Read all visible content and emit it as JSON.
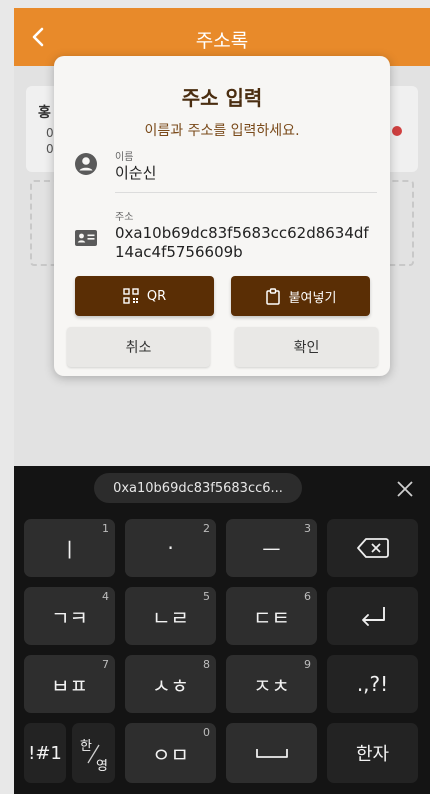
{
  "app_bar": {
    "title": "주소록"
  },
  "background": {
    "card_title": "홍",
    "card_line1": "0",
    "card_line2": "0"
  },
  "dialog": {
    "title": "주소 입력",
    "subtitle": "이름과 주소를 입력하세요.",
    "name_field": {
      "label": "이름",
      "value": "이순신"
    },
    "address_field": {
      "label": "주소",
      "value_line1": "0xa10b69dc83f5683cc62d8634df",
      "value_line2": "14ac4f5756609b"
    },
    "qr_button": "QR",
    "paste_button": "붙여넣기",
    "cancel_button": "취소",
    "confirm_button": "확인"
  },
  "keyboard": {
    "suggestion": "0xa10b69dc83f5683cc6...",
    "rows": [
      [
        {
          "label": "ㅣ",
          "num": "1"
        },
        {
          "label": "·",
          "num": "2"
        },
        {
          "label": "ㅡ",
          "num": "3"
        }
      ],
      [
        {
          "label": "ㄱㅋ",
          "num": "4"
        },
        {
          "label": "ㄴㄹ",
          "num": "5"
        },
        {
          "label": "ㄷㅌ",
          "num": "6"
        }
      ],
      [
        {
          "label": "ㅂㅍ",
          "num": "7"
        },
        {
          "label": "ㅅㅎ",
          "num": "8"
        },
        {
          "label": "ㅈㅊ",
          "num": "9"
        },
        {
          "label": ".,?!"
        }
      ]
    ],
    "symbols_key": "!#1",
    "lang_key_top": "한",
    "lang_key_bottom": "영",
    "bottom_key": {
      "label": "ㅇㅁ",
      "num": "0"
    },
    "hanja_key": "한자"
  },
  "colors": {
    "app_bar": "#e88a2a",
    "brand_brown": "#5a2e05",
    "title_brown": "#4a2d10",
    "keyboard_bg": "#141414",
    "key_bg": "#2e2e2e"
  }
}
